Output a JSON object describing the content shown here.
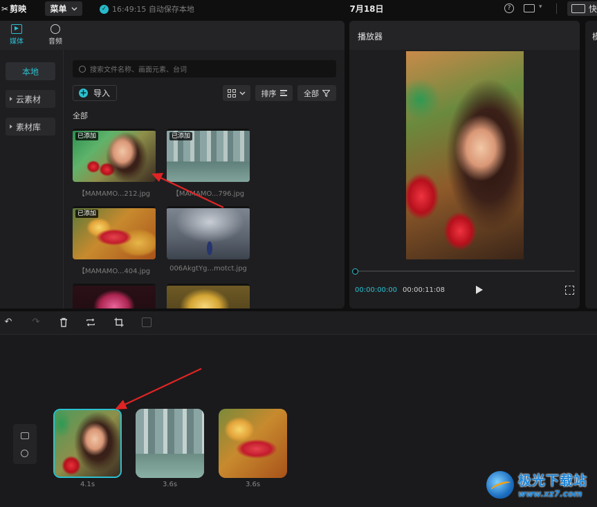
{
  "topbar": {
    "app_name": "剪映",
    "menu_label": "菜单",
    "save_status": "16:49:15 自动保存本地",
    "date": "7月18日",
    "help_glyph": "?",
    "shortcut_label": "快"
  },
  "media_panel": {
    "tabs": [
      {
        "label": "媒体",
        "icon": "media-icon",
        "active": true
      },
      {
        "label": "音频",
        "icon": "audio-icon",
        "active": false
      }
    ],
    "side_nav": [
      {
        "label": "本地"
      },
      {
        "label": "云素材"
      },
      {
        "label": "素材库"
      }
    ],
    "search_placeholder": "搜索文件名称、画面元素、台词",
    "import_label": "导入",
    "sort_label": "排序",
    "filter_label": "全部",
    "section_label": "全部",
    "items": [
      {
        "name": "【MAMAMO...212.jpg",
        "badge": "已添加"
      },
      {
        "name": "【MAMAMO...796.jpg",
        "badge": "已添加"
      },
      {
        "name": "【MAMAMO...404.jpg",
        "badge": "已添加"
      },
      {
        "name": "006AkgtYg...motct.jpg",
        "badge": ""
      },
      {
        "name": "",
        "badge": ""
      },
      {
        "name": "",
        "badge": ""
      }
    ]
  },
  "player": {
    "title": "播放器",
    "current_time": "00:00:00:00",
    "total_time": "00:00:11:08",
    "progress": 0.0
  },
  "right_panel": {
    "title": "模"
  },
  "timeline": {
    "clips": [
      {
        "duration": "4.1s",
        "selected": true
      },
      {
        "duration": "3.6s",
        "selected": false
      },
      {
        "duration": "3.6s",
        "selected": false
      }
    ]
  },
  "watermark": {
    "title": "极光下载站",
    "url": "www.xz7.com"
  },
  "colors": {
    "accent": "#2bc0d0",
    "annotation_arrow": "#e02424",
    "background": "#0f0f10",
    "panel": "#1e1e20"
  }
}
